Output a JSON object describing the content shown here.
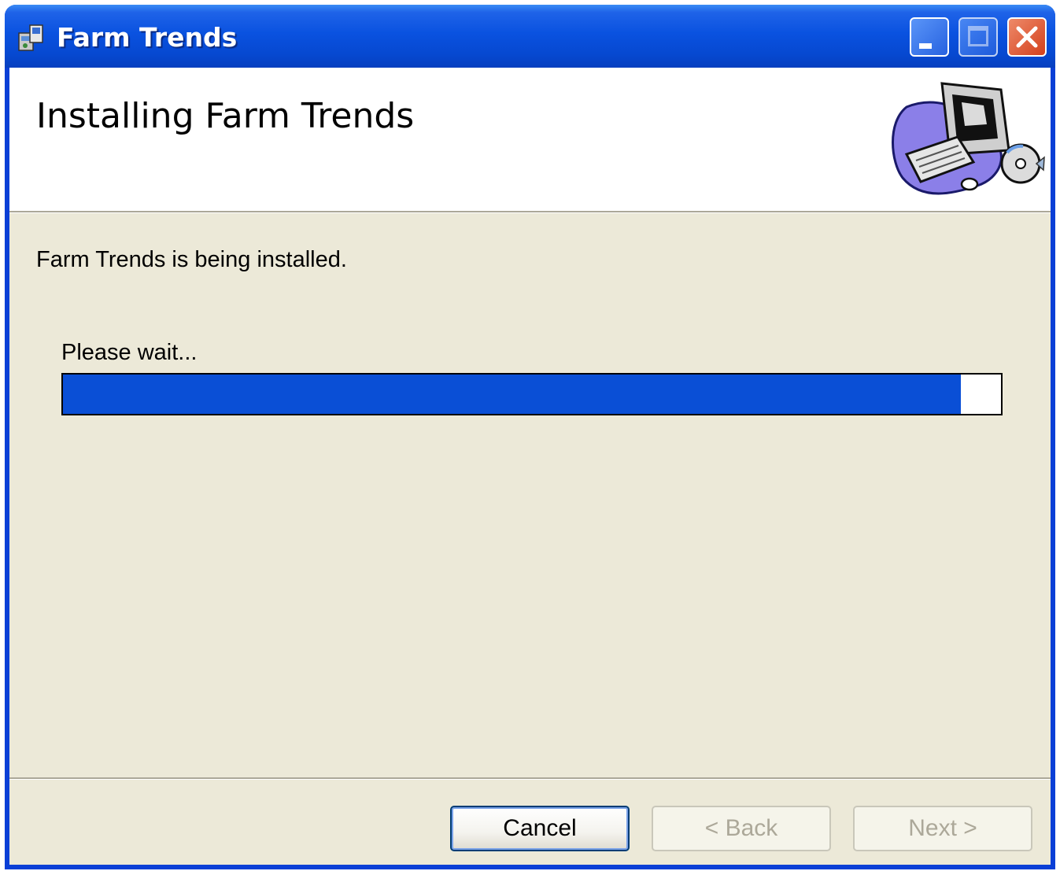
{
  "window": {
    "title": "Farm Trends",
    "accent": "#0a52e0",
    "close_color": "#d4401c"
  },
  "header": {
    "title": "Installing Farm Trends",
    "art_icon": "computer-install-icon"
  },
  "main": {
    "status_text": "Farm Trends is being installed.",
    "wait_text": "Please wait...",
    "progress_fraction": 0.957,
    "progress_color": "#0a4fd6"
  },
  "buttons": {
    "cancel": "Cancel",
    "back": "< Back",
    "next": "Next >"
  }
}
